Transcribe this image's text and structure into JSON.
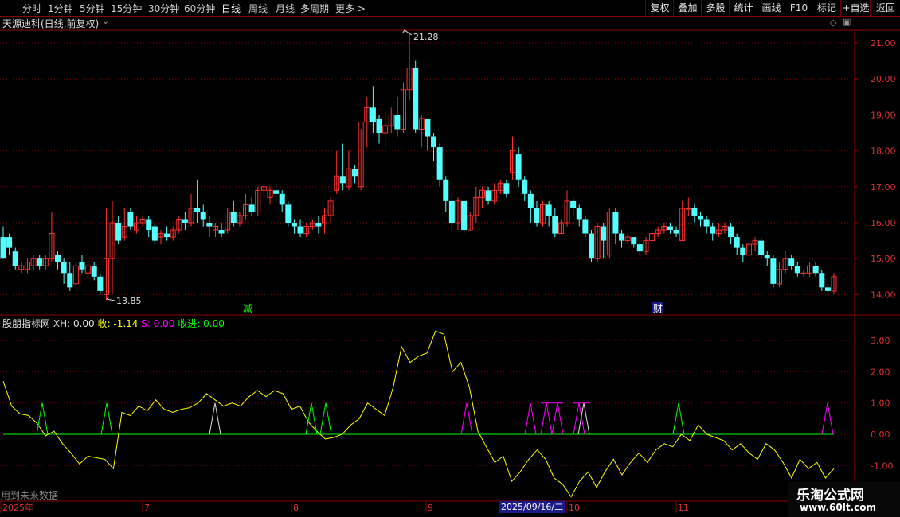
{
  "toolbar": {
    "periods": [
      "分时",
      "1分钟",
      "5分钟",
      "15分钟",
      "30分钟",
      "60分钟",
      "日线",
      "周线",
      "月线",
      "多周期",
      "更多 >"
    ],
    "active_period": "日线",
    "right_buttons": [
      "复权",
      "叠加",
      "多股",
      "统计",
      "画线",
      "F10",
      "标记",
      "+自选",
      "返回"
    ]
  },
  "stock": {
    "title": "天源迪科(日线,前复权)",
    "high_label": "21.28",
    "low_label": "13.85",
    "markers": [
      "减",
      "财"
    ]
  },
  "indicator": {
    "name": "股朋指标网",
    "items": [
      {
        "label": "XH: 0.00",
        "color": "#e0e0e0"
      },
      {
        "label": "收: -1.14",
        "color": "#ffff00"
      },
      {
        "label": "S: 0.00",
        "color": "#ff00ff"
      },
      {
        "label": "收进: 0.00",
        "color": "#00ff00"
      }
    ]
  },
  "price_axis": [
    "21.00",
    "20.00",
    "19.00",
    "18.00",
    "17.00",
    "16.00",
    "15.00",
    "14.00"
  ],
  "ind_axis": [
    "3.00",
    "2.00",
    "1.00",
    "0.00",
    "-1.00"
  ],
  "date_axis": [
    "2025年",
    "7",
    "8",
    "9",
    "10",
    "11"
  ],
  "cursor_date": "2025/09/16/二",
  "footer": {
    "future_note": "用到未来数据"
  },
  "watermark": {
    "line1": "乐淘公式网",
    "line2": "www.60lt.com"
  },
  "colors": {
    "up": "#ff3232",
    "down": "#54ffff",
    "grid": "#8b0000",
    "line_yellow": "#ffff00",
    "line_green": "#00ff00",
    "line_magenta": "#ff00ff"
  },
  "chart_data": {
    "type": "candlestick",
    "candles": [
      [
        15.6,
        15.0,
        15.9,
        15.0
      ],
      [
        15.6,
        15.3,
        15.7,
        15.1
      ],
      [
        15.2,
        14.8,
        15.3,
        14.7
      ],
      [
        14.7,
        14.8,
        14.9,
        14.6
      ],
      [
        14.7,
        14.9,
        15.0,
        14.6
      ],
      [
        14.8,
        15.0,
        15.1,
        14.7
      ],
      [
        15.0,
        14.8,
        15.1,
        14.7
      ],
      [
        14.8,
        15.0,
        15.1,
        14.7
      ],
      [
        15.0,
        15.7,
        16.3,
        14.9
      ],
      [
        15.1,
        14.9,
        15.2,
        14.7
      ],
      [
        14.9,
        14.6,
        15.0,
        14.3
      ],
      [
        14.6,
        14.2,
        14.9,
        14.1
      ],
      [
        14.3,
        14.8,
        14.9,
        14.2
      ],
      [
        14.9,
        14.7,
        15.1,
        14.6
      ],
      [
        14.6,
        14.8,
        15.0,
        14.5
      ],
      [
        14.8,
        14.5,
        14.9,
        14.4
      ],
      [
        14.5,
        14.1,
        14.6,
        14.0
      ],
      [
        14.0,
        15.0,
        16.4,
        13.85
      ],
      [
        15.0,
        16.0,
        16.6,
        14.0
      ],
      [
        16.0,
        15.5,
        16.2,
        15.4
      ],
      [
        15.6,
        15.9,
        16.4,
        15.5
      ],
      [
        16.3,
        15.9,
        16.4,
        15.8
      ],
      [
        15.8,
        16.0,
        16.2,
        15.7
      ],
      [
        16.0,
        16.1,
        16.2,
        15.9
      ],
      [
        16.1,
        15.8,
        16.2,
        15.6
      ],
      [
        15.9,
        15.5,
        16.0,
        15.4
      ],
      [
        15.6,
        15.7,
        15.8,
        15.4
      ],
      [
        15.7,
        15.6,
        15.9,
        15.5
      ],
      [
        15.6,
        15.8,
        15.9,
        15.5
      ],
      [
        15.8,
        16.1,
        16.2,
        15.7
      ],
      [
        16.1,
        16.0,
        16.3,
        15.8
      ],
      [
        16.0,
        16.4,
        16.8,
        15.9
      ],
      [
        16.4,
        16.3,
        17.2,
        16.0
      ],
      [
        16.3,
        16.1,
        16.5,
        15.9
      ],
      [
        16.0,
        15.9,
        16.2,
        15.6
      ],
      [
        15.8,
        15.9,
        16.0,
        15.6
      ],
      [
        15.8,
        15.7,
        16.0,
        15.6
      ],
      [
        15.8,
        16.3,
        16.4,
        15.7
      ],
      [
        16.3,
        16.0,
        16.6,
        15.9
      ],
      [
        16.0,
        16.2,
        16.3,
        15.9
      ],
      [
        16.2,
        16.5,
        16.8,
        16.1
      ],
      [
        16.5,
        16.3,
        16.7,
        16.2
      ],
      [
        16.3,
        16.9,
        17.0,
        16.2
      ],
      [
        16.9,
        17.0,
        17.1,
        16.7
      ],
      [
        16.7,
        16.9,
        17.0,
        16.5
      ],
      [
        16.9,
        16.8,
        17.1,
        16.6
      ],
      [
        16.8,
        16.5,
        16.9,
        16.3
      ],
      [
        16.5,
        16.0,
        16.6,
        15.9
      ],
      [
        16.0,
        15.9,
        16.1,
        15.7
      ],
      [
        15.9,
        15.7,
        16.1,
        15.6
      ],
      [
        15.7,
        15.9,
        16.0,
        15.6
      ],
      [
        15.9,
        16.0,
        16.1,
        15.8
      ],
      [
        16.0,
        15.9,
        16.2,
        15.7
      ],
      [
        16.0,
        16.2,
        16.4,
        15.7
      ],
      [
        16.2,
        16.6,
        16.7,
        16.0
      ],
      [
        16.9,
        17.3,
        18.0,
        16.8
      ],
      [
        17.3,
        17.1,
        18.2,
        16.9
      ],
      [
        17.0,
        17.5,
        18.0,
        16.9
      ],
      [
        17.5,
        17.3,
        17.6,
        17.1
      ],
      [
        17.0,
        18.8,
        18.6,
        16.9
      ],
      [
        18.8,
        19.2,
        19.5,
        18.1
      ],
      [
        19.2,
        18.8,
        19.8,
        18.5
      ],
      [
        18.9,
        18.5,
        19.0,
        18.2
      ],
      [
        18.5,
        18.7,
        19.1,
        18.1
      ],
      [
        18.7,
        19.0,
        19.2,
        18.5
      ],
      [
        19.0,
        18.6,
        19.5,
        18.4
      ],
      [
        18.6,
        19.7,
        19.9,
        18.5
      ],
      [
        19.7,
        20.3,
        21.28,
        19.4
      ],
      [
        20.3,
        18.6,
        20.5,
        18.5
      ],
      [
        18.6,
        18.9,
        19.0,
        18.1
      ],
      [
        18.9,
        18.4,
        18.9,
        18.0
      ],
      [
        18.4,
        18.1,
        18.5,
        17.7
      ],
      [
        18.1,
        17.2,
        18.2,
        17.0
      ],
      [
        17.2,
        16.6,
        17.3,
        16.3
      ],
      [
        16.6,
        16.0,
        16.8,
        15.8
      ],
      [
        16.0,
        16.6,
        16.7,
        15.8
      ],
      [
        16.6,
        15.8,
        16.6,
        15.7
      ],
      [
        15.8,
        16.2,
        16.3,
        15.8
      ],
      [
        16.2,
        16.7,
        17.0,
        16.0
      ],
      [
        16.7,
        16.9,
        17.0,
        16.4
      ],
      [
        16.9,
        16.6,
        17.0,
        16.5
      ],
      [
        16.6,
        16.9,
        17.1,
        16.5
      ],
      [
        16.9,
        17.1,
        17.2,
        16.8
      ],
      [
        17.1,
        16.8,
        17.2,
        16.7
      ],
      [
        17.4,
        18.0,
        18.4,
        17.2
      ],
      [
        17.9,
        17.2,
        18.1,
        17.0
      ],
      [
        17.2,
        16.8,
        17.3,
        16.6
      ],
      [
        16.8,
        16.4,
        16.9,
        16.0
      ],
      [
        16.4,
        16.0,
        16.6,
        15.9
      ],
      [
        16.0,
        16.5,
        16.6,
        15.9
      ],
      [
        16.5,
        16.2,
        16.6,
        15.9
      ],
      [
        16.2,
        15.7,
        16.4,
        15.6
      ],
      [
        15.7,
        16.0,
        16.1,
        15.7
      ],
      [
        16.0,
        16.6,
        16.9,
        15.9
      ],
      [
        16.6,
        16.4,
        16.7,
        16.2
      ],
      [
        16.4,
        16.1,
        16.5,
        15.9
      ],
      [
        16.1,
        15.7,
        16.2,
        15.6
      ],
      [
        15.7,
        15.0,
        15.8,
        14.9
      ],
      [
        15.0,
        15.9,
        16.0,
        14.9
      ],
      [
        15.9,
        15.5,
        16.0,
        15.0
      ],
      [
        15.1,
        16.3,
        16.4,
        15.0
      ],
      [
        16.3,
        15.7,
        16.4,
        15.4
      ],
      [
        15.7,
        15.5,
        15.8,
        15.3
      ],
      [
        15.5,
        15.6,
        15.7,
        15.4
      ],
      [
        15.6,
        15.4,
        15.6,
        15.3
      ],
      [
        15.4,
        15.2,
        15.5,
        15.1
      ],
      [
        15.2,
        15.5,
        15.6,
        15.1
      ],
      [
        15.5,
        15.7,
        15.8,
        15.5
      ],
      [
        15.7,
        15.8,
        15.9,
        15.6
      ],
      [
        15.8,
        15.9,
        16.0,
        15.7
      ],
      [
        15.9,
        15.8,
        16.0,
        15.7
      ],
      [
        15.8,
        15.7,
        15.9,
        15.6
      ],
      [
        15.5,
        16.4,
        16.6,
        15.5
      ],
      [
        16.4,
        16.4,
        16.7,
        16.2
      ],
      [
        16.4,
        16.2,
        16.5,
        16.0
      ],
      [
        16.2,
        16.1,
        16.3,
        15.9
      ],
      [
        16.1,
        15.9,
        16.2,
        15.7
      ],
      [
        15.9,
        15.7,
        16.0,
        15.5
      ],
      [
        15.7,
        15.8,
        16.0,
        15.6
      ],
      [
        15.8,
        15.9,
        16.0,
        15.7
      ],
      [
        15.9,
        15.6,
        16.0,
        15.4
      ],
      [
        15.6,
        15.3,
        15.7,
        15.1
      ],
      [
        15.3,
        15.1,
        15.4,
        14.9
      ],
      [
        15.1,
        15.4,
        15.6,
        15.0
      ],
      [
        15.4,
        15.5,
        15.6,
        15.2
      ],
      [
        15.5,
        15.1,
        15.6,
        15.0
      ],
      [
        15.1,
        15.0,
        15.2,
        14.8
      ],
      [
        15.0,
        14.3,
        15.1,
        14.2
      ],
      [
        14.3,
        14.7,
        14.9,
        14.2
      ],
      [
        14.7,
        15.0,
        15.2,
        14.6
      ],
      [
        15.0,
        14.8,
        15.1,
        14.7
      ],
      [
        14.8,
        14.6,
        14.9,
        14.5
      ],
      [
        14.6,
        14.6,
        14.7,
        14.5
      ],
      [
        14.6,
        14.8,
        14.9,
        14.5
      ],
      [
        14.8,
        14.6,
        14.9,
        14.5
      ],
      [
        14.6,
        14.2,
        14.7,
        14.1
      ],
      [
        14.2,
        14.1,
        14.3,
        14.0
      ],
      [
        14.1,
        14.5,
        14.6,
        14.0
      ]
    ]
  }
}
